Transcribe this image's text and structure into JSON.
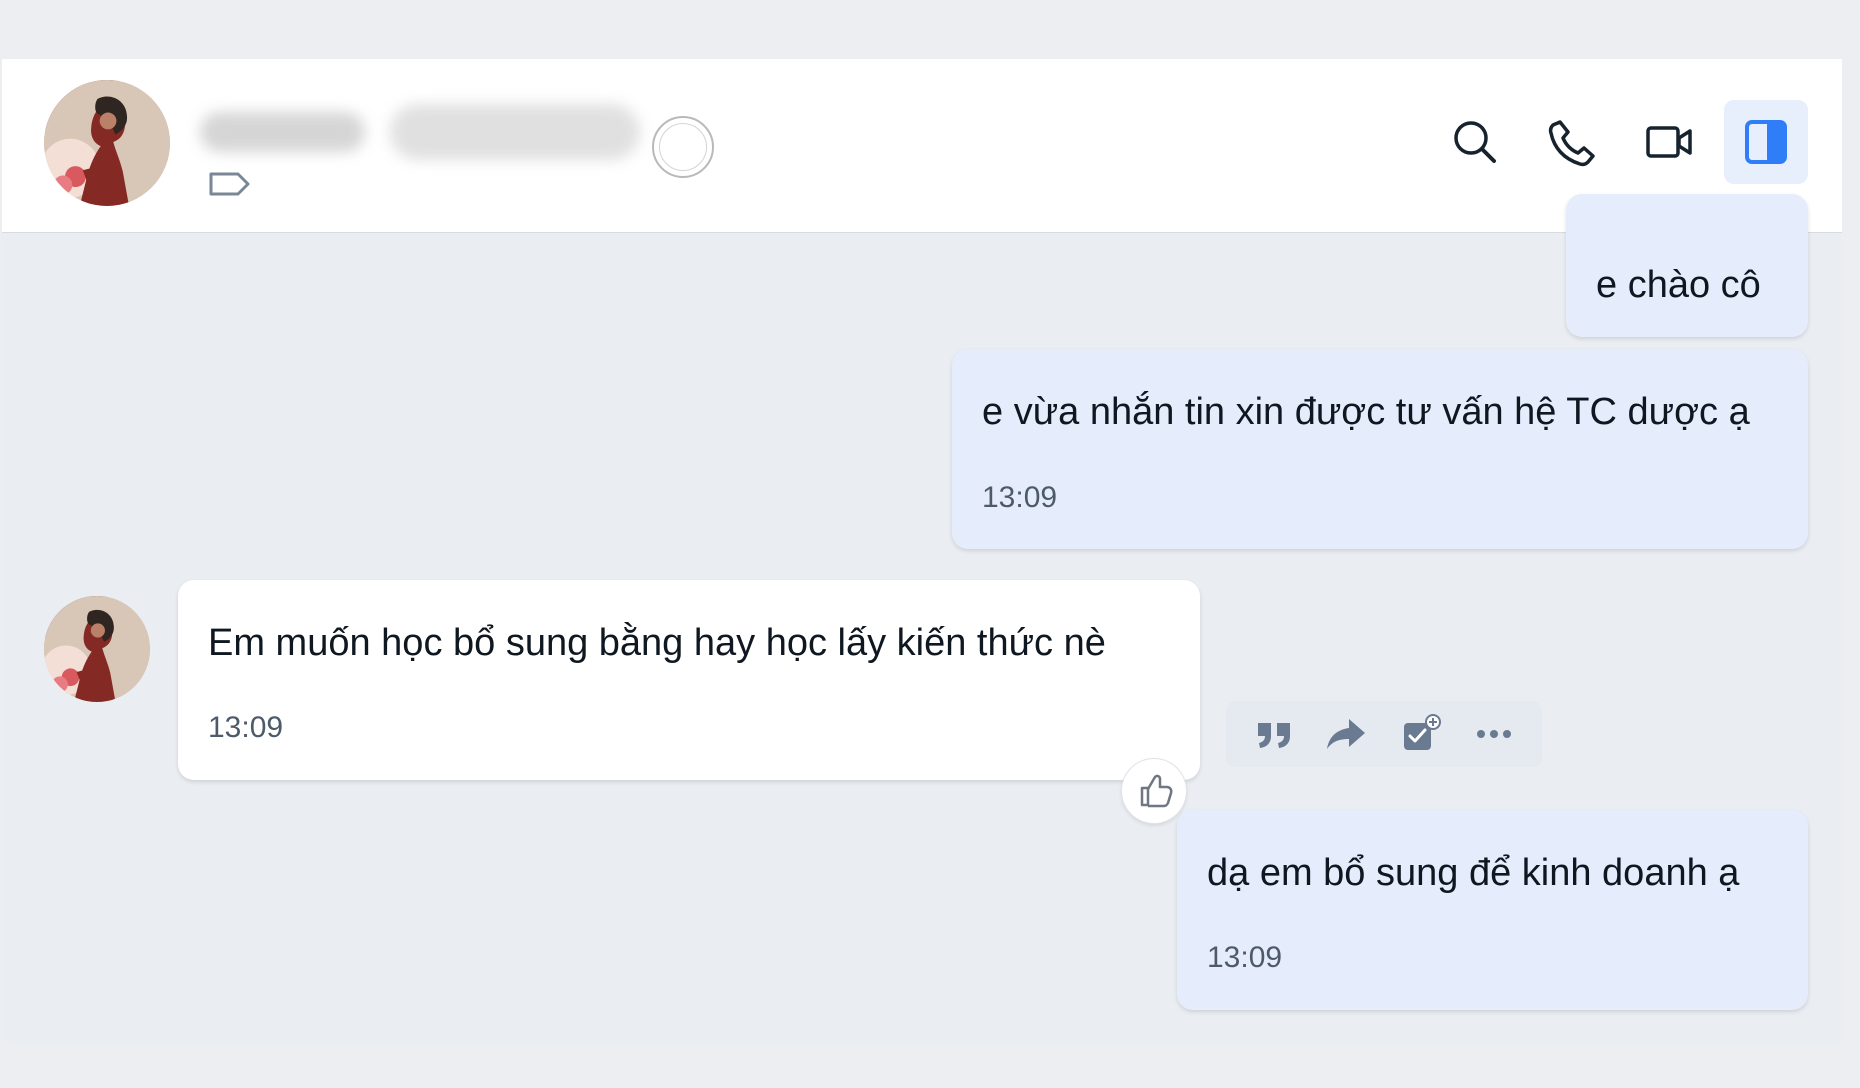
{
  "header": {
    "action_icons": [
      "search-icon",
      "phone-icon",
      "video-icon",
      "side-panel-icon"
    ],
    "accent_color": "#2f7ef7"
  },
  "messages": [
    {
      "direction": "outgoing",
      "text": "e chào cô"
    },
    {
      "direction": "outgoing",
      "text": "e vừa nhắn tin xin được tư vấn hệ TC dược ạ",
      "time": "13:09"
    },
    {
      "direction": "incoming",
      "text": "Em muốn học bổ sung bằng hay học lấy kiến thức nè",
      "time": "13:09"
    },
    {
      "direction": "outgoing",
      "text": "dạ em bổ sung để kinh doanh ạ",
      "time": "13:09"
    }
  ],
  "message_actions": {
    "icons": [
      "quote-icon",
      "forward-icon",
      "add-task-icon",
      "more-icon"
    ],
    "reaction_icon": "thumbs-up-icon"
  }
}
